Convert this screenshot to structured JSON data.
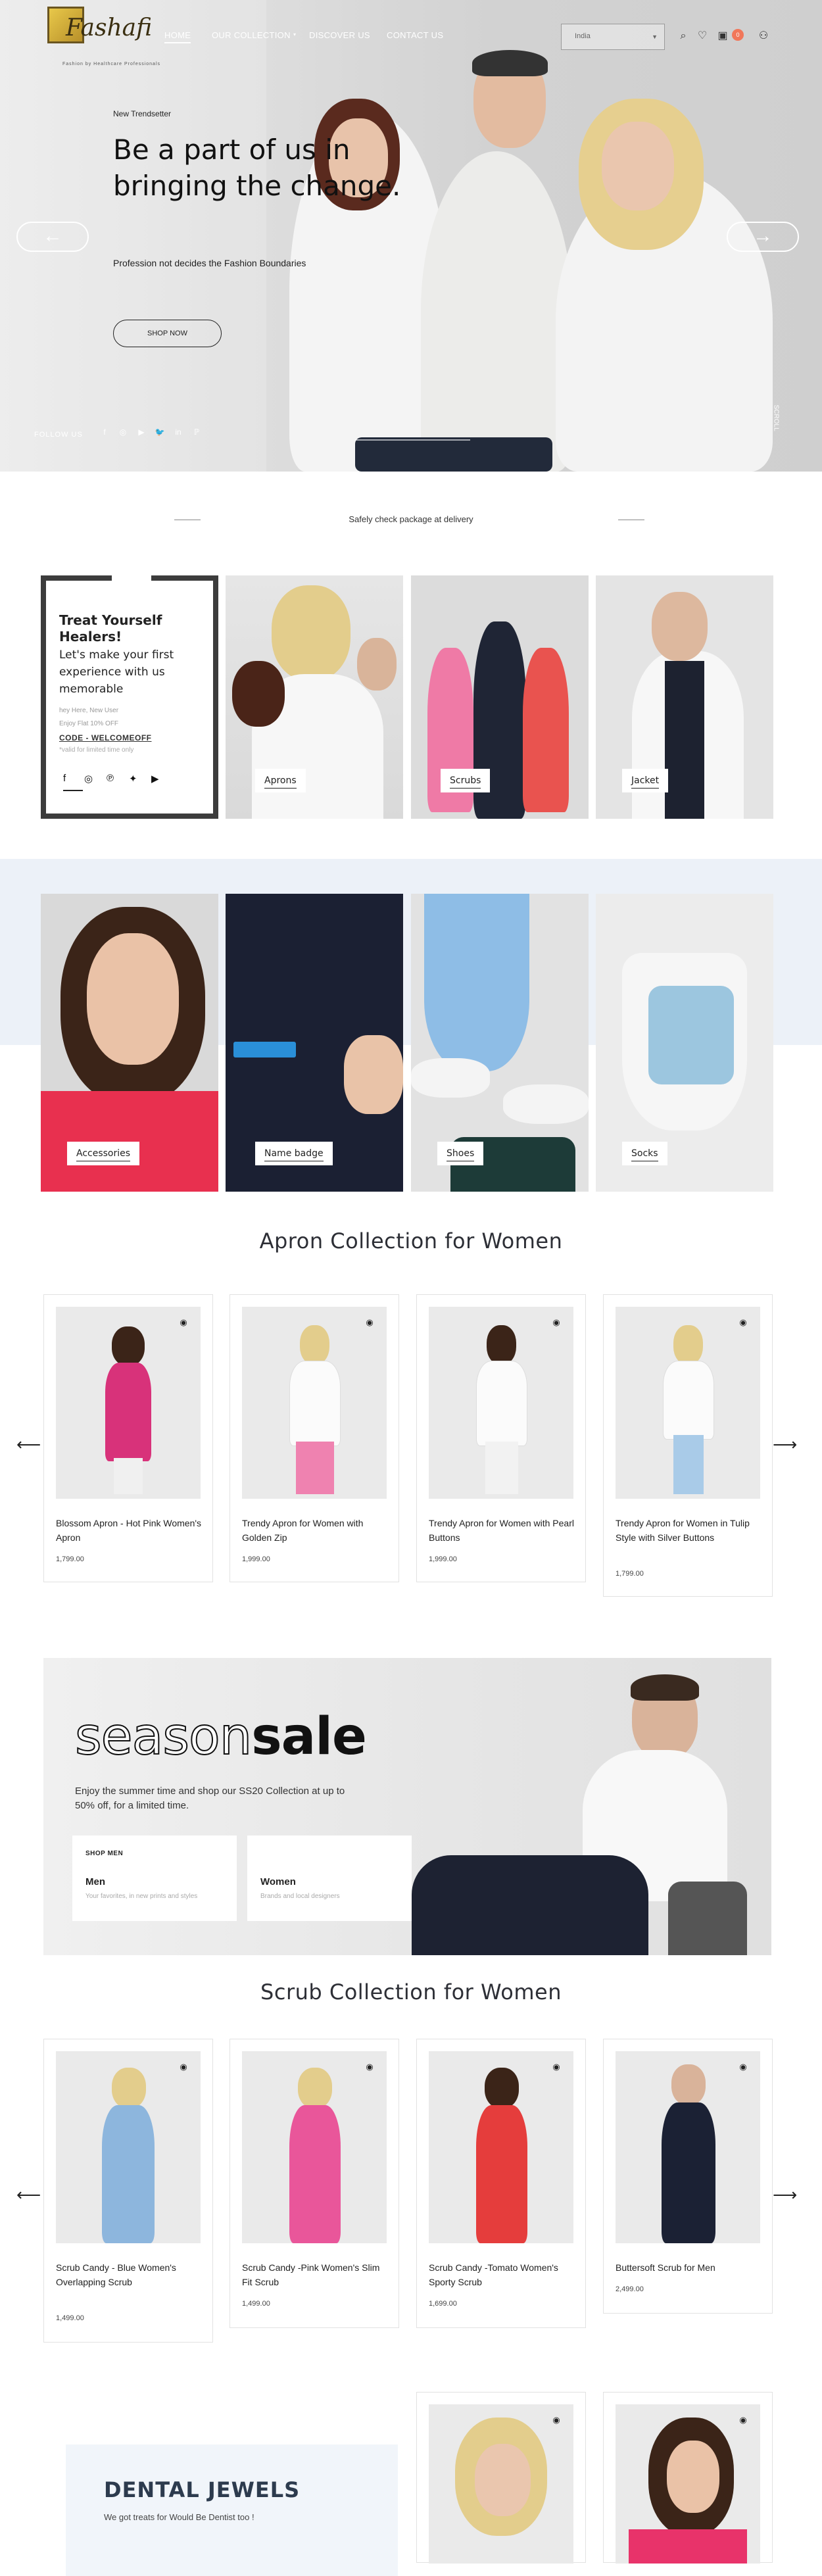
{
  "header": {
    "brand": "Fashafi",
    "tagline": "Fashion by Healthcare Professionals",
    "nav": [
      "HOME",
      "OUR COLLECTION",
      "DISCOVER US",
      "CONTACT US"
    ],
    "country": "India",
    "cart_count": "0",
    "icons": [
      "search-icon",
      "heart-icon",
      "cart-icon",
      "user-icon"
    ]
  },
  "hero": {
    "eyebrow": "New Trendsetter",
    "headline": "Be a part of us in bringing the change.",
    "subtitle": "Profession not decides the Fashion Boundaries",
    "cta": "SHOP NOW",
    "follow": "FOLLOW US",
    "scroll": "SCROLL",
    "prev": "←",
    "next": "→",
    "social": [
      "f",
      "◎",
      "▶",
      "🐦",
      "in",
      "ℙ"
    ]
  },
  "strip": {
    "text": "Safely check package at delivery"
  },
  "treat": {
    "title": "Treat Yourself Healers!",
    "subtitle": "Let's make your first experience with us memorable",
    "line1": "hey Here, New User",
    "line2": "Enjoy Flat 10% OFF",
    "code": "CODE - WELCOMEOFF",
    "note": "*valid for limited time only"
  },
  "categories_top": [
    "Aprons",
    "Scrubs",
    "Jacket"
  ],
  "categories_bottom": [
    "Accessories",
    "Name badge",
    "Shoes",
    "Socks"
  ],
  "apron": {
    "title": "Apron Collection for Women",
    "products": [
      {
        "name": "Blossom Apron - Hot Pink Women's Apron",
        "price": "1,799.00"
      },
      {
        "name": "Trendy Apron for Women with Golden Zip",
        "price": "1,999.00"
      },
      {
        "name": "Trendy Apron for Women with Pearl Buttons",
        "price": "1,999.00"
      },
      {
        "name": "Trendy Apron for Women in Tulip Style with Silver Buttons",
        "price": "1,799.00"
      }
    ]
  },
  "sale": {
    "light": "season",
    "bold": "sale",
    "desc": "Enjoy the summer time and shop our SS20 Collection at up to 50% off, for a limited time.",
    "cards": [
      {
        "kicker": "SHOP MEN",
        "title": "Men",
        "sub": "Your favorites, in new prints and styles"
      },
      {
        "kicker": "",
        "title": "Women",
        "sub": "Brands and local designers"
      }
    ]
  },
  "scrub": {
    "title": "Scrub Collection for Women",
    "products": [
      {
        "name": "Scrub Candy - Blue Women's Overlapping Scrub",
        "price": "1,499.00"
      },
      {
        "name": "Scrub Candy -Pink Women's Slim Fit Scrub",
        "price": "1,499.00"
      },
      {
        "name": "Scrub Candy -Tomato Women's Sporty Scrub",
        "price": "1,699.00"
      },
      {
        "name": "Buttersoft Scrub for Men",
        "price": "2,499.00"
      }
    ]
  },
  "dental": {
    "title": "DENTAL JEWELS",
    "text": "We got treats for Would Be Dentist too !"
  },
  "colors": {
    "accent": "#f1775a",
    "band": "#ecf1f8",
    "dark": "#2d2f36"
  }
}
